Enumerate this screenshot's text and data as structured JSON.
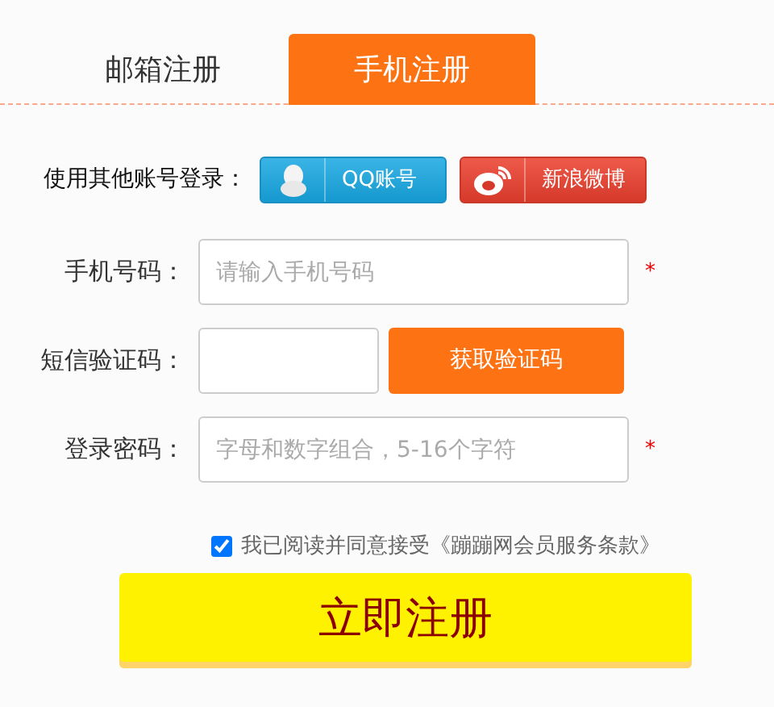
{
  "tabs": [
    {
      "label": "邮箱注册",
      "selected": false
    },
    {
      "label": "手机注册",
      "selected": true
    }
  ],
  "social_login": {
    "label": "使用其他账号登录：",
    "buttons": [
      {
        "kind": "qq",
        "label": "QQ账号"
      },
      {
        "kind": "weibo",
        "label": "新浪微博"
      }
    ]
  },
  "fields": [
    {
      "kind": "input",
      "label": "手机号码：",
      "placeholder": "请输入手机号码",
      "required_mark": "*"
    },
    {
      "kind": "code",
      "label": "短信验证码：",
      "button": "获取验证码"
    },
    {
      "kind": "input",
      "label": "登录密码：",
      "placeholder": "字母和数字组合，5-16个字符",
      "required_mark": "*"
    }
  ],
  "agreement": {
    "checked": true,
    "text": "我已阅读并同意接受《蹦蹦网会员服务条款》"
  },
  "submit": "立即注册"
}
